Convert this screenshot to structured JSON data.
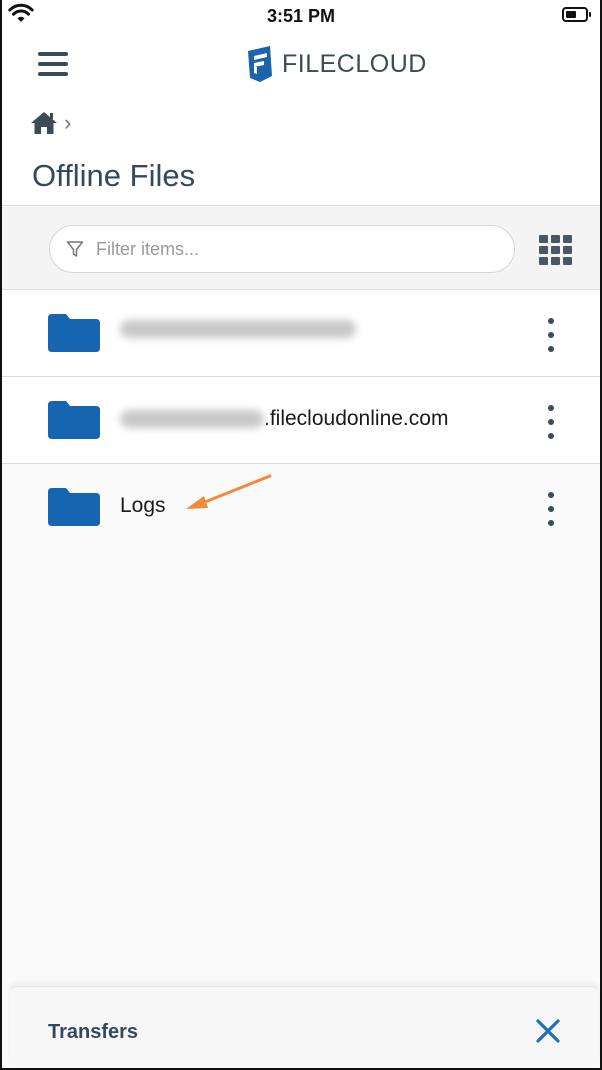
{
  "status_bar": {
    "time": "3:51 PM"
  },
  "header": {
    "brand": "FILECLOUD",
    "page_title": "Offline Files"
  },
  "filter": {
    "placeholder": "Filter items..."
  },
  "items": [
    {
      "name_suffix": "",
      "name_obscured": true,
      "icon": "folder-icon"
    },
    {
      "name_suffix": ".filecloudonline.com",
      "name_obscured": true,
      "icon": "folder-icon"
    },
    {
      "name_suffix": "Logs",
      "name_obscured": false,
      "icon": "folder-icon"
    }
  ],
  "transfers": {
    "label": "Transfers"
  },
  "colors": {
    "folder": "#1565b0",
    "header_text": "#34495e",
    "annotation_arrow": "#f08a3c",
    "close_icon": "#1f6fb8"
  }
}
